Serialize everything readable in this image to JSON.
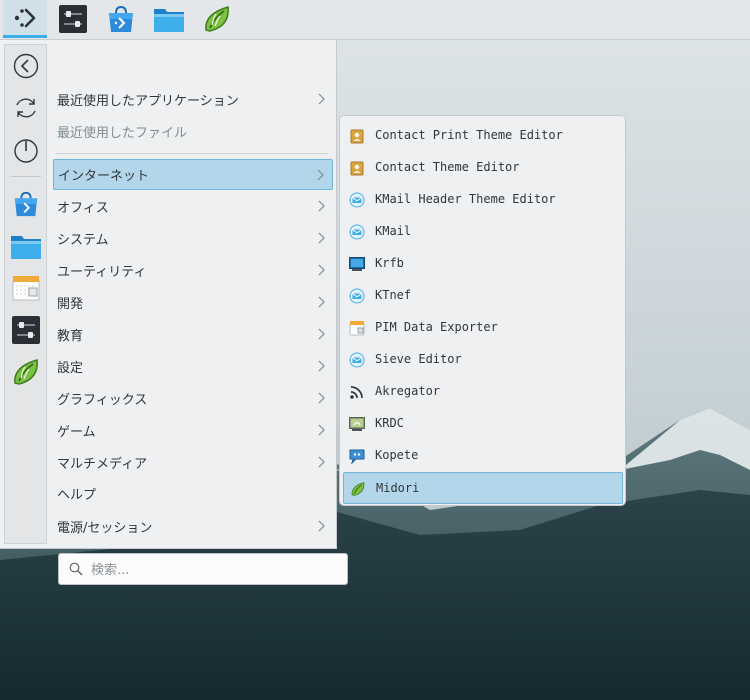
{
  "panel": {
    "tasks": [
      {
        "icon": "application-launcher-icon",
        "active": true
      },
      {
        "icon": "system-settings-icon"
      },
      {
        "icon": "discover-store-icon"
      },
      {
        "icon": "dolphin-folder-icon"
      },
      {
        "icon": "midori-leaf-icon"
      }
    ]
  },
  "favorites": [
    "back-arrow-icon",
    "refresh-icon",
    "power-icon",
    "discover-store-icon",
    "dolphin-folder-icon",
    "kontact-calendar-icon",
    "system-settings-icon",
    "midori-leaf-icon"
  ],
  "categories": [
    {
      "label": "最近使用したアプリケーション",
      "arrow": true
    },
    {
      "label": "最近使用したファイル",
      "arrow": false,
      "dim": true
    },
    {
      "label": "インターネット",
      "arrow": true,
      "selected": true
    },
    {
      "label": "オフィス",
      "arrow": true
    },
    {
      "label": "システム",
      "arrow": true
    },
    {
      "label": "ユーティリティ",
      "arrow": true
    },
    {
      "label": "開発",
      "arrow": true
    },
    {
      "label": "教育",
      "arrow": true
    },
    {
      "label": "設定",
      "arrow": true
    },
    {
      "label": "グラフィックス",
      "arrow": true
    },
    {
      "label": "ゲーム",
      "arrow": true
    },
    {
      "label": "マルチメディア",
      "arrow": true
    },
    {
      "label": "ヘルプ",
      "arrow": false
    },
    {
      "label": "電源/セッション",
      "arrow": true
    }
  ],
  "search": {
    "placeholder": "検索..."
  },
  "submenu": {
    "items": [
      {
        "label": "Contact Print Theme Editor",
        "icon": "contact-theme-icon"
      },
      {
        "label": "Contact Theme Editor",
        "icon": "contact-theme-icon"
      },
      {
        "label": "KMail Header Theme Editor",
        "icon": "kmail-icon"
      },
      {
        "label": "KMail",
        "icon": "kmail-icon"
      },
      {
        "label": "Krfb",
        "icon": "krfb-desktop-icon"
      },
      {
        "label": "KTnef",
        "icon": "kmail-icon"
      },
      {
        "label": "PIM Data Exporter",
        "icon": "pim-exporter-icon"
      },
      {
        "label": "Sieve Editor",
        "icon": "kmail-icon"
      },
      {
        "label": "Akregator",
        "icon": "rss-feed-icon"
      },
      {
        "label": "KRDC",
        "icon": "krdc-remote-desktop-icon"
      },
      {
        "label": "Kopete",
        "icon": "kopete-chat-icon"
      },
      {
        "label": "Midori",
        "icon": "midori-leaf-icon",
        "selected": true
      }
    ]
  },
  "colors": {
    "accent": "#3daee9",
    "selection": "#b4d6ea",
    "menu_bg": "#eff0f1"
  }
}
